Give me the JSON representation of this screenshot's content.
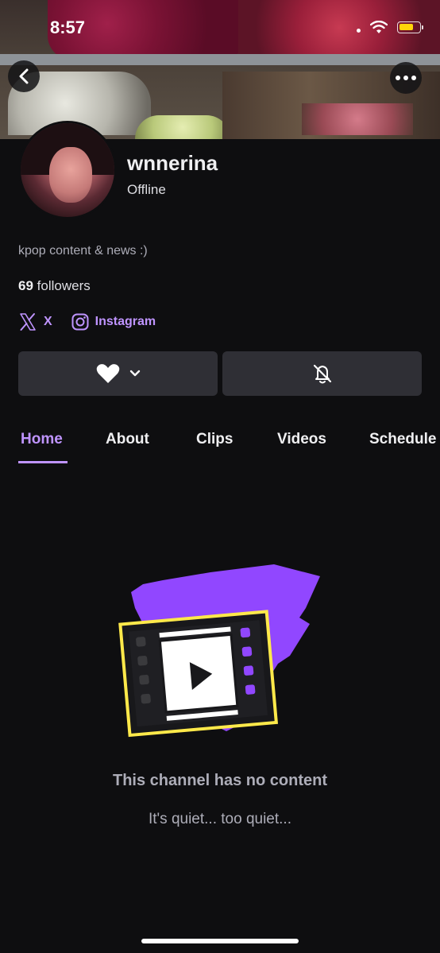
{
  "status_bar": {
    "time": "8:57"
  },
  "profile": {
    "username": "wnnerina",
    "status": "Offline",
    "bio": "kpop content & news :)",
    "followers_count": "69",
    "followers_label": "followers"
  },
  "socials": [
    {
      "label": "X",
      "icon": "x-logo-icon"
    },
    {
      "label": "Instagram",
      "icon": "instagram-icon"
    }
  ],
  "actions": {
    "follow_icon": "heart-icon",
    "notify_icon": "bell-off-icon"
  },
  "tabs": [
    {
      "label": "Home",
      "active": true
    },
    {
      "label": "About",
      "active": false
    },
    {
      "label": "Clips",
      "active": false
    },
    {
      "label": "Videos",
      "active": false
    },
    {
      "label": "Schedule",
      "active": false
    }
  ],
  "empty_state": {
    "title": "This channel has no content",
    "subtitle": "It's quiet... too quiet..."
  },
  "colors": {
    "background": "#0e0e10",
    "accent": "#bf94ff",
    "button_bg": "#2f2f35",
    "illustration_purple": "#9147ff",
    "illustration_yellow": "#ffe94a"
  }
}
